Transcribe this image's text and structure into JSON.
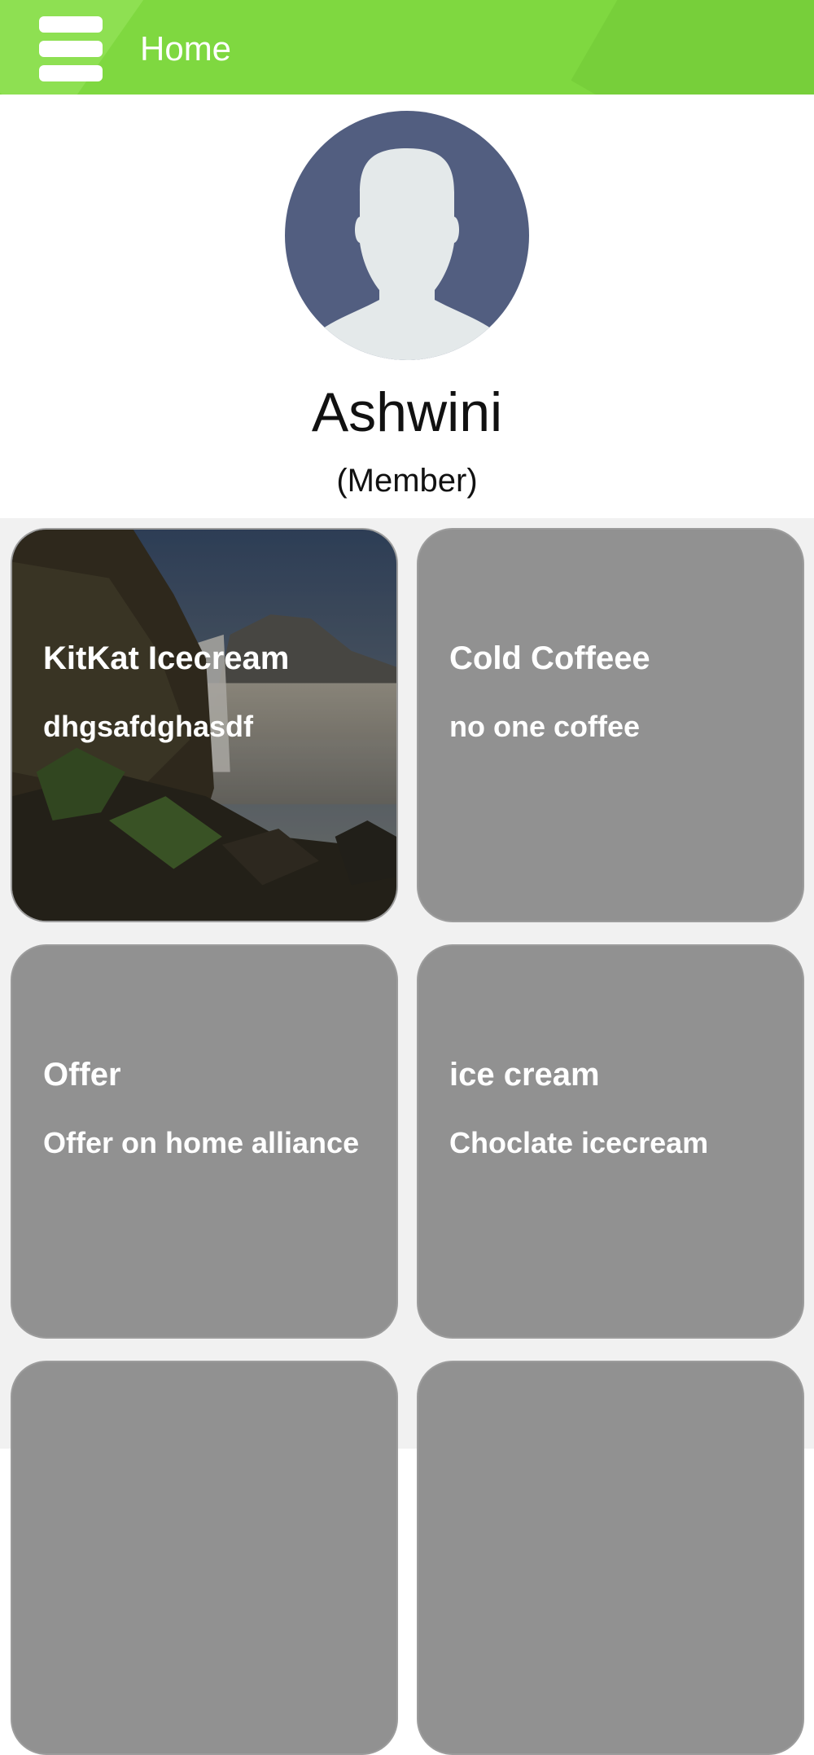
{
  "header": {
    "title": "Home",
    "accent_color": "#7fd840",
    "menu_icon": "hamburger-menu-icon"
  },
  "profile": {
    "name": "Ashwini",
    "role": "(Member)",
    "avatar_icon": "default-user-avatar-icon",
    "avatar_bg_color": "#525e80"
  },
  "cards": [
    {
      "title": "KitKat Icecream",
      "subtitle": "dhgsafdghasdf",
      "has_image": true
    },
    {
      "title": "Cold Coffeee",
      "subtitle": "no one coffee",
      "has_image": false
    },
    {
      "title": "Offer",
      "subtitle": "Offer on home  alliance",
      "has_image": false
    },
    {
      "title": "ice cream",
      "subtitle": "Choclate icecream",
      "has_image": false
    },
    {
      "title": "",
      "subtitle": "",
      "has_image": false
    },
    {
      "title": "",
      "subtitle": "",
      "has_image": false
    }
  ],
  "colors": {
    "card_bg": "#919191",
    "card_text": "#ffffff"
  }
}
